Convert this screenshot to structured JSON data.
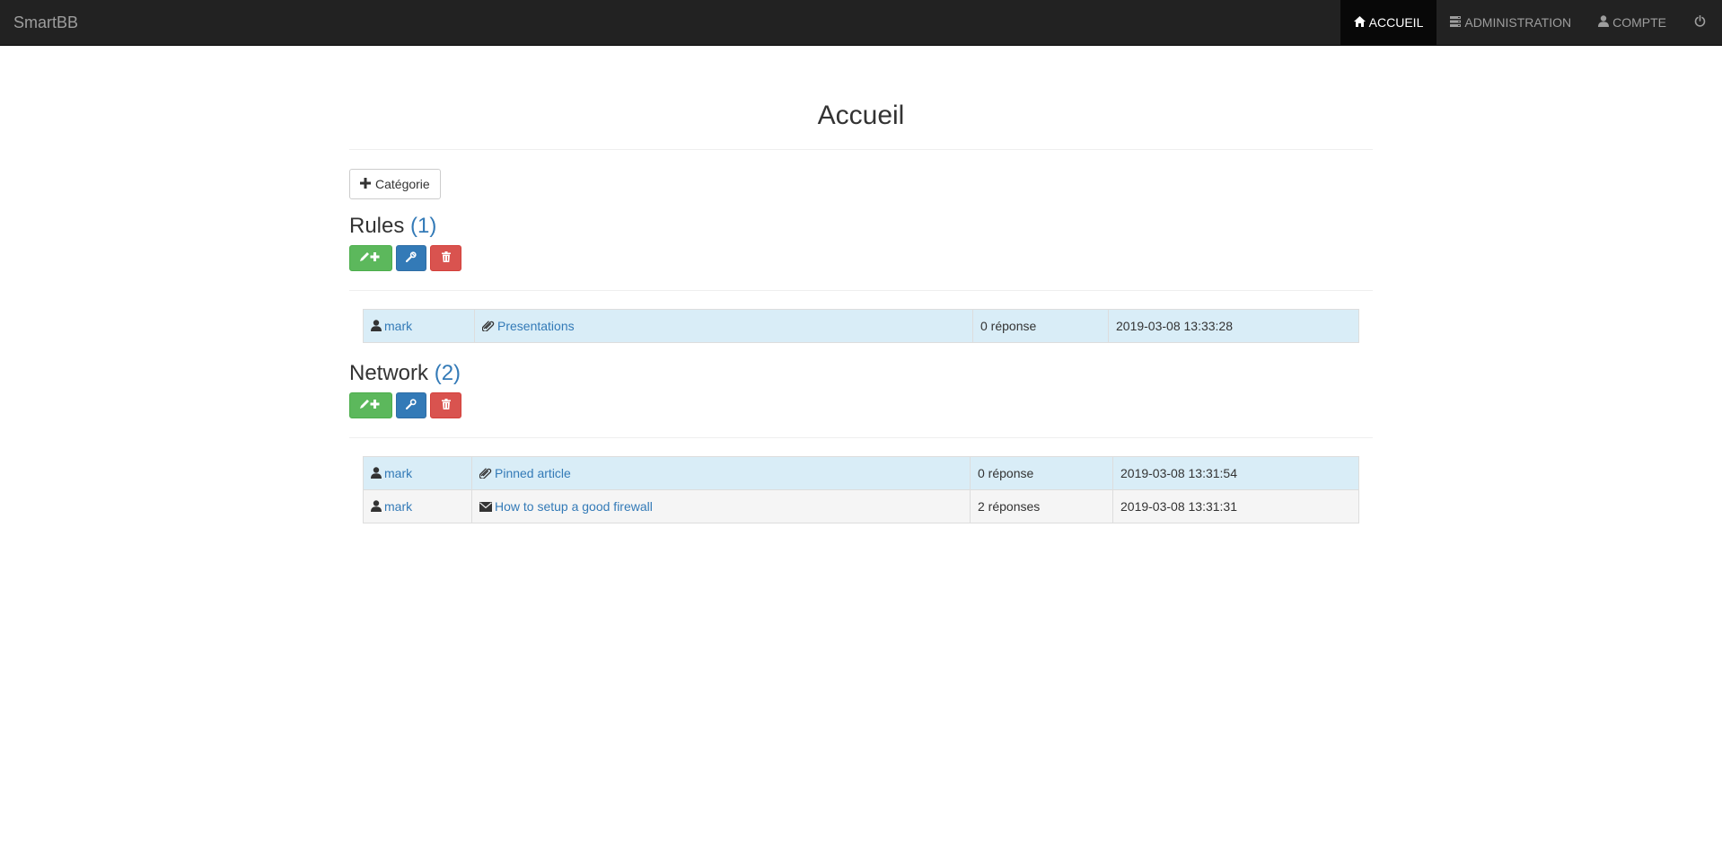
{
  "app": {
    "brand": "SmartBB"
  },
  "nav": {
    "items": [
      {
        "label": "ACCUEIL",
        "icon": "home-icon",
        "active": true
      },
      {
        "label": "ADMINISTRATION",
        "icon": "server-icon",
        "active": false
      },
      {
        "label": "COMPTE",
        "icon": "user-icon",
        "active": false
      }
    ],
    "logout_icon": "power-icon"
  },
  "page": {
    "title": "Accueil",
    "add_category_label": "Catégorie"
  },
  "categories": [
    {
      "name": "Rules",
      "count": "(1)",
      "topics": [
        {
          "author": "mark",
          "type_icon": "paperclip-icon",
          "title": "Presentations",
          "replies": "0 réponse",
          "date": "2019-03-08 13:33:28",
          "pinned": true
        }
      ]
    },
    {
      "name": "Network",
      "count": "(2)",
      "topics": [
        {
          "author": "mark",
          "type_icon": "paperclip-icon",
          "title": "Pinned article",
          "replies": "0 réponse",
          "date": "2019-03-08 13:31:54",
          "pinned": true
        },
        {
          "author": "mark",
          "type_icon": "envelope-icon",
          "title": "How to setup a good firewall",
          "replies": "2 réponses",
          "date": "2019-03-08 13:31:31",
          "pinned": false
        }
      ]
    }
  ],
  "colors": {
    "navbar_bg": "#222222",
    "navbar_active": "#080808",
    "link": "#337ab7",
    "success": "#5cb85c",
    "primary": "#337ab7",
    "danger": "#d9534f",
    "pinned_row": "#d9edf7",
    "normal_row": "#f5f5f5"
  }
}
